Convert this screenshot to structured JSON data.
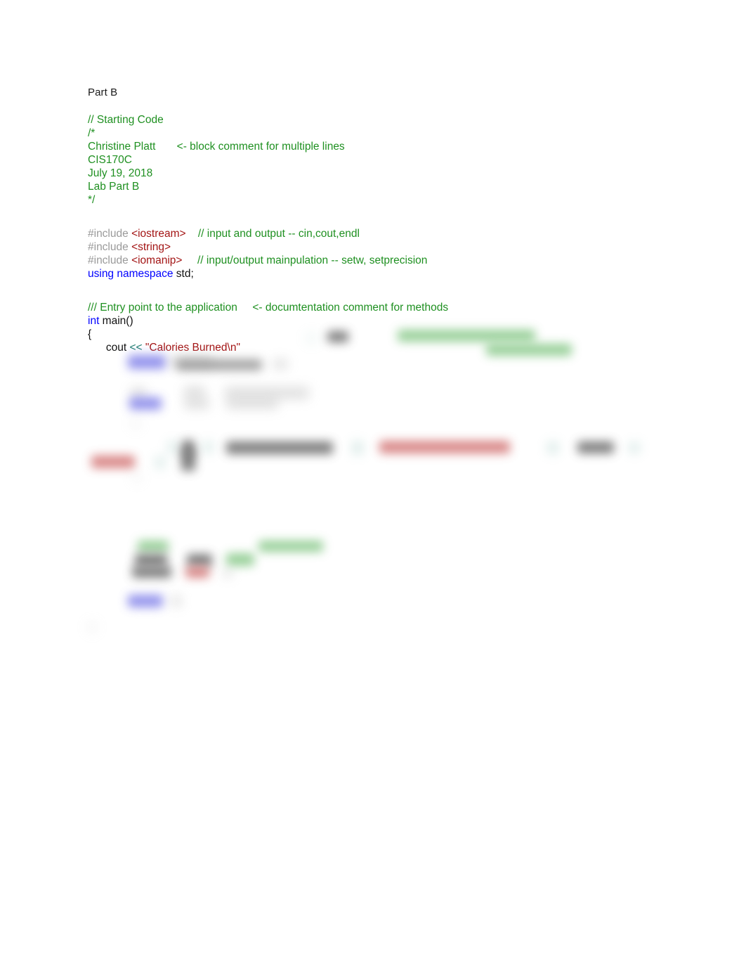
{
  "document": {
    "background_color": "#ffffff",
    "title": "Part B",
    "code_block": {
      "lines": [
        {
          "id": "l1",
          "text": "// Starting Code",
          "kind": "comment"
        },
        {
          "id": "l2",
          "text": "/*",
          "kind": "comment"
        },
        {
          "id": "l3",
          "text": "Christine Platt",
          "kind": "comment",
          "trailing": "<- block comment for multiple lines"
        },
        {
          "id": "l4",
          "text": "CIS170C",
          "kind": "comment"
        },
        {
          "id": "l5",
          "text": "July 19, 2018",
          "kind": "comment"
        },
        {
          "id": "l6",
          "text": "Lab Part B",
          "kind": "comment"
        },
        {
          "id": "l7",
          "text": "*/",
          "kind": "comment"
        },
        {
          "id": "l8",
          "text": "",
          "kind": "blank"
        },
        {
          "id": "l9",
          "preproc": "#include",
          "header": "<iostream>",
          "comment": "// input and output -- cin,cout,endl"
        },
        {
          "id": "l10",
          "preproc": "#include",
          "header": "<string>",
          "comment": ""
        },
        {
          "id": "l11",
          "preproc": "#include",
          "header": "<iomanip>",
          "comment": "// input/output mainpulation -- setw, setprecision"
        },
        {
          "id": "l12",
          "keyword": "using namespace",
          "plain": " std;"
        },
        {
          "id": "l13",
          "text": "",
          "kind": "blank"
        },
        {
          "id": "l14",
          "text": "/// Entry point to the application",
          "kind": "comment",
          "trailing": "<- documtentation comment for methods"
        },
        {
          "id": "l15",
          "keyword": "int",
          "plain": " main()"
        },
        {
          "id": "l16",
          "plain": "{"
        },
        {
          "id": "l17",
          "indent": "cout",
          "op": " << ",
          "string": "\"Calories Burned\\n\""
        }
      ]
    },
    "redacted_note": "Remaining code lines below are blurred and unreadable in the source image."
  },
  "colors": {
    "comment_green": "#1f9021",
    "preprocessor_grey": "#9a9a9a",
    "header_red": "#a31515",
    "keyword_blue": "#0000ff",
    "string_red": "#a31515",
    "operator_teal": "#1e7d6e",
    "text_black": "#111111"
  }
}
